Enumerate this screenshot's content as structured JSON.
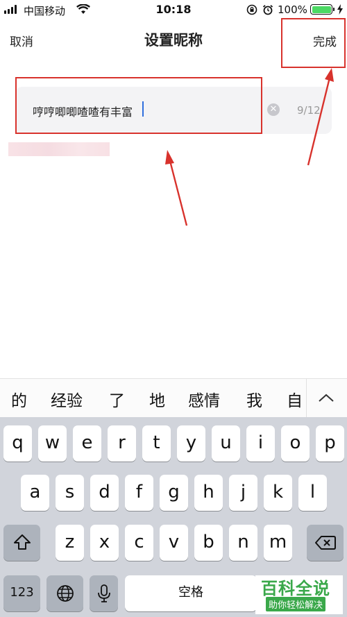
{
  "status_bar": {
    "carrier": "中国移动",
    "time": "10:18",
    "battery": "100%"
  },
  "nav": {
    "cancel": "取消",
    "title": "设置昵称",
    "done": "完成"
  },
  "nickname_input": {
    "value": "哼哼唧唧喳喳有丰富",
    "counter": "9/12"
  },
  "suggestions": [
    "的",
    "经验",
    "了",
    "地",
    "感情",
    "我",
    "自"
  ],
  "keyboard": {
    "row1": [
      "q",
      "w",
      "e",
      "r",
      "t",
      "y",
      "u",
      "i",
      "o",
      "p"
    ],
    "row2": [
      "a",
      "s",
      "d",
      "f",
      "g",
      "h",
      "j",
      "k",
      "l"
    ],
    "row3": [
      "z",
      "x",
      "c",
      "v",
      "b",
      "n",
      "m"
    ],
    "numbers_key": "123",
    "space_key": "空格"
  },
  "watermark": {
    "title": "百科全说",
    "subtitle": "助你轻松解决"
  },
  "colors": {
    "annotation_red": "#d8322c",
    "caret_blue": "#2f6fde",
    "keyboard_bg": "#d1d4db",
    "watermark_green": "#3aa84a"
  }
}
